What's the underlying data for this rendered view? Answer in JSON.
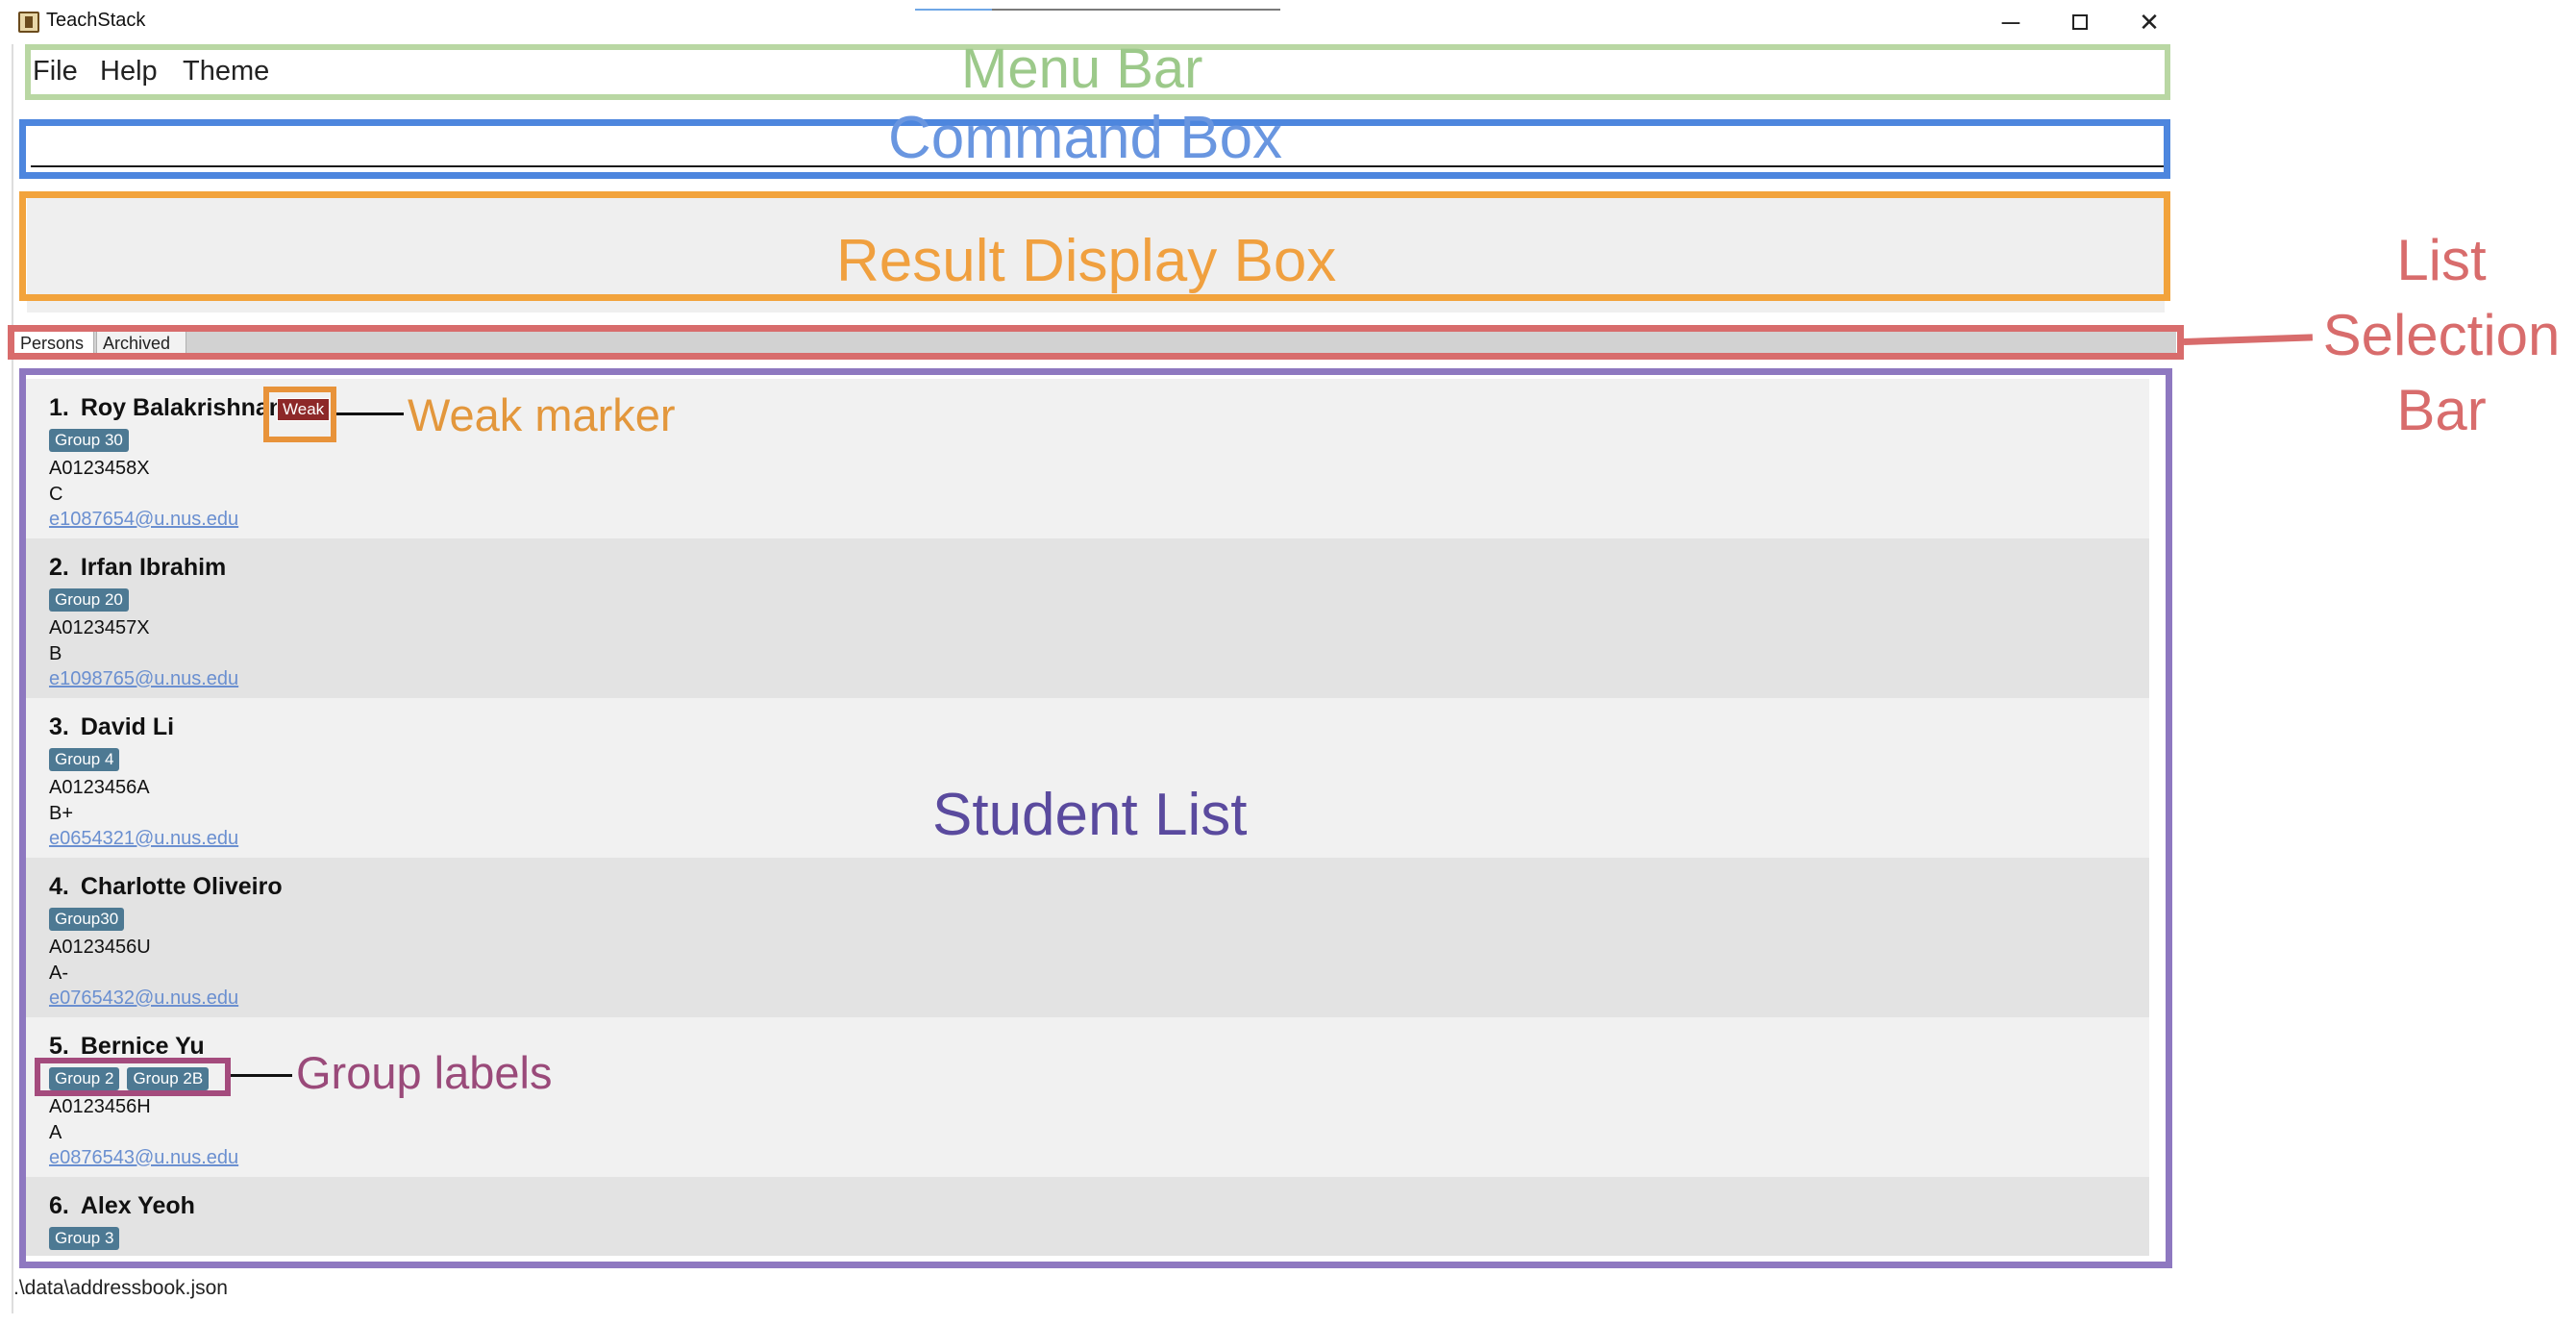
{
  "window": {
    "title": "TeachStack",
    "minimize_glyph": "─",
    "close_glyph": "✕"
  },
  "menu": {
    "items": [
      "File",
      "Help",
      "Theme"
    ]
  },
  "command_box": {
    "value": "",
    "placeholder": ""
  },
  "result_display": {
    "text": ""
  },
  "tabs": [
    {
      "label": "Persons",
      "selected": true
    },
    {
      "label": "Archived",
      "selected": false
    }
  ],
  "students": [
    {
      "index": "1.",
      "name": "Roy Balakrishnan",
      "groups": [
        "Group 30"
      ],
      "id": "A0123458X",
      "grade": "C",
      "email": "e1087654@u.nus.edu",
      "weak_label": "Weak"
    },
    {
      "index": "2.",
      "name": "Irfan Ibrahim",
      "groups": [
        "Group 20"
      ],
      "id": "A0123457X",
      "grade": "B",
      "email": "e1098765@u.nus.edu"
    },
    {
      "index": "3.",
      "name": "David Li",
      "groups": [
        "Group 4"
      ],
      "id": "A0123456A",
      "grade": "B+",
      "email": "e0654321@u.nus.edu"
    },
    {
      "index": "4.",
      "name": "Charlotte Oliveiro",
      "groups": [
        "Group30"
      ],
      "id": "A0123456U",
      "grade": "A-",
      "email": "e0765432@u.nus.edu"
    },
    {
      "index": "5.",
      "name": "Bernice Yu",
      "groups": [
        "Group 2",
        "Group 2B"
      ],
      "id": "A0123456H",
      "grade": "A",
      "email": "e0876543@u.nus.edu"
    },
    {
      "index": "6.",
      "name": "Alex Yeoh",
      "groups": [
        "Group 3"
      ],
      "id": "",
      "grade": "",
      "email": ""
    }
  ],
  "status_bar": {
    "path": ".\\data\\addressbook.json"
  },
  "annotations": {
    "menu_bar": "Menu Bar",
    "command_box": "Command Box",
    "result_display": "Result Display Box",
    "list_selection": [
      "List",
      "Selection",
      "Bar"
    ],
    "student_list": "Student List",
    "weak_marker": "Weak marker",
    "group_labels": "Group labels"
  },
  "colors": {
    "menu_annotation": "#9cc98a",
    "command_annotation": "#4d86de",
    "result_annotation": "#f2a33c",
    "list_selection_annotation": "#d86c6c",
    "student_list_annotation": "#8e78c0",
    "tag": "#4d7993",
    "weak_tag": "#8d2828"
  }
}
